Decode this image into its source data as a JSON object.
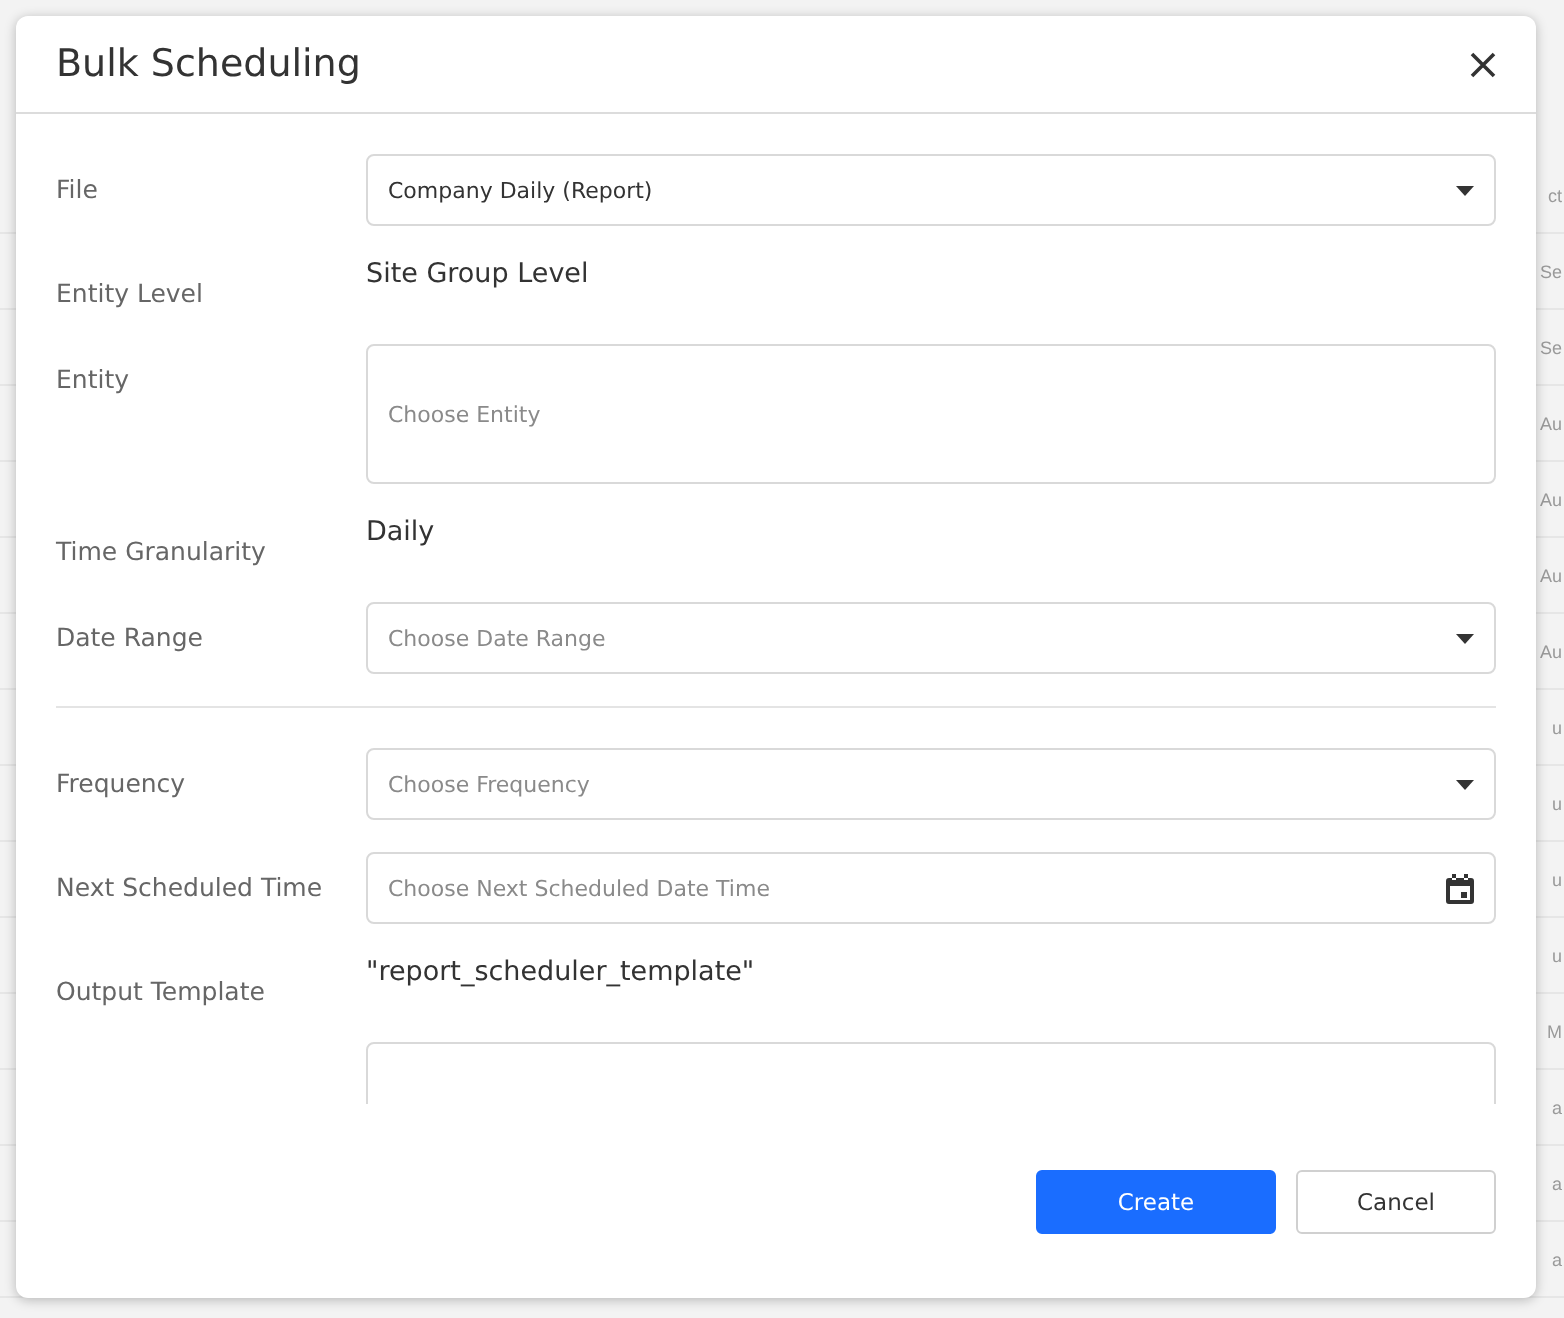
{
  "background_rows": [
    "ct",
    "Se",
    "Se",
    "Au",
    "Au",
    "Au",
    "Au",
    "u",
    "u",
    "u",
    "u",
    "M",
    "a",
    "a",
    "a"
  ],
  "dialog": {
    "title": "Bulk Scheduling",
    "fields": [
      {
        "kind": "select",
        "label": "File",
        "value": "Company Daily (Report)"
      },
      {
        "kind": "text",
        "label": "Entity Level",
        "value": "Site Group Level"
      },
      {
        "kind": "textarea",
        "label": "Entity",
        "placeholder": "Choose Entity"
      },
      {
        "kind": "text",
        "label": "Time Granularity",
        "value": "Daily"
      },
      {
        "kind": "select",
        "label": "Date Range",
        "placeholder": "Choose Date Range"
      },
      {
        "kind": "divider"
      },
      {
        "kind": "select",
        "label": "Frequency",
        "placeholder": "Choose Frequency"
      },
      {
        "kind": "date",
        "label": "Next Scheduled Time",
        "placeholder": "Choose Next Scheduled Date Time"
      },
      {
        "kind": "text",
        "label": "Output Template",
        "value": "\"report_scheduler_template\""
      },
      {
        "kind": "cut"
      }
    ],
    "buttons": [
      {
        "label": "Create",
        "primary": true
      },
      {
        "label": "Cancel",
        "primary": false
      }
    ]
  }
}
